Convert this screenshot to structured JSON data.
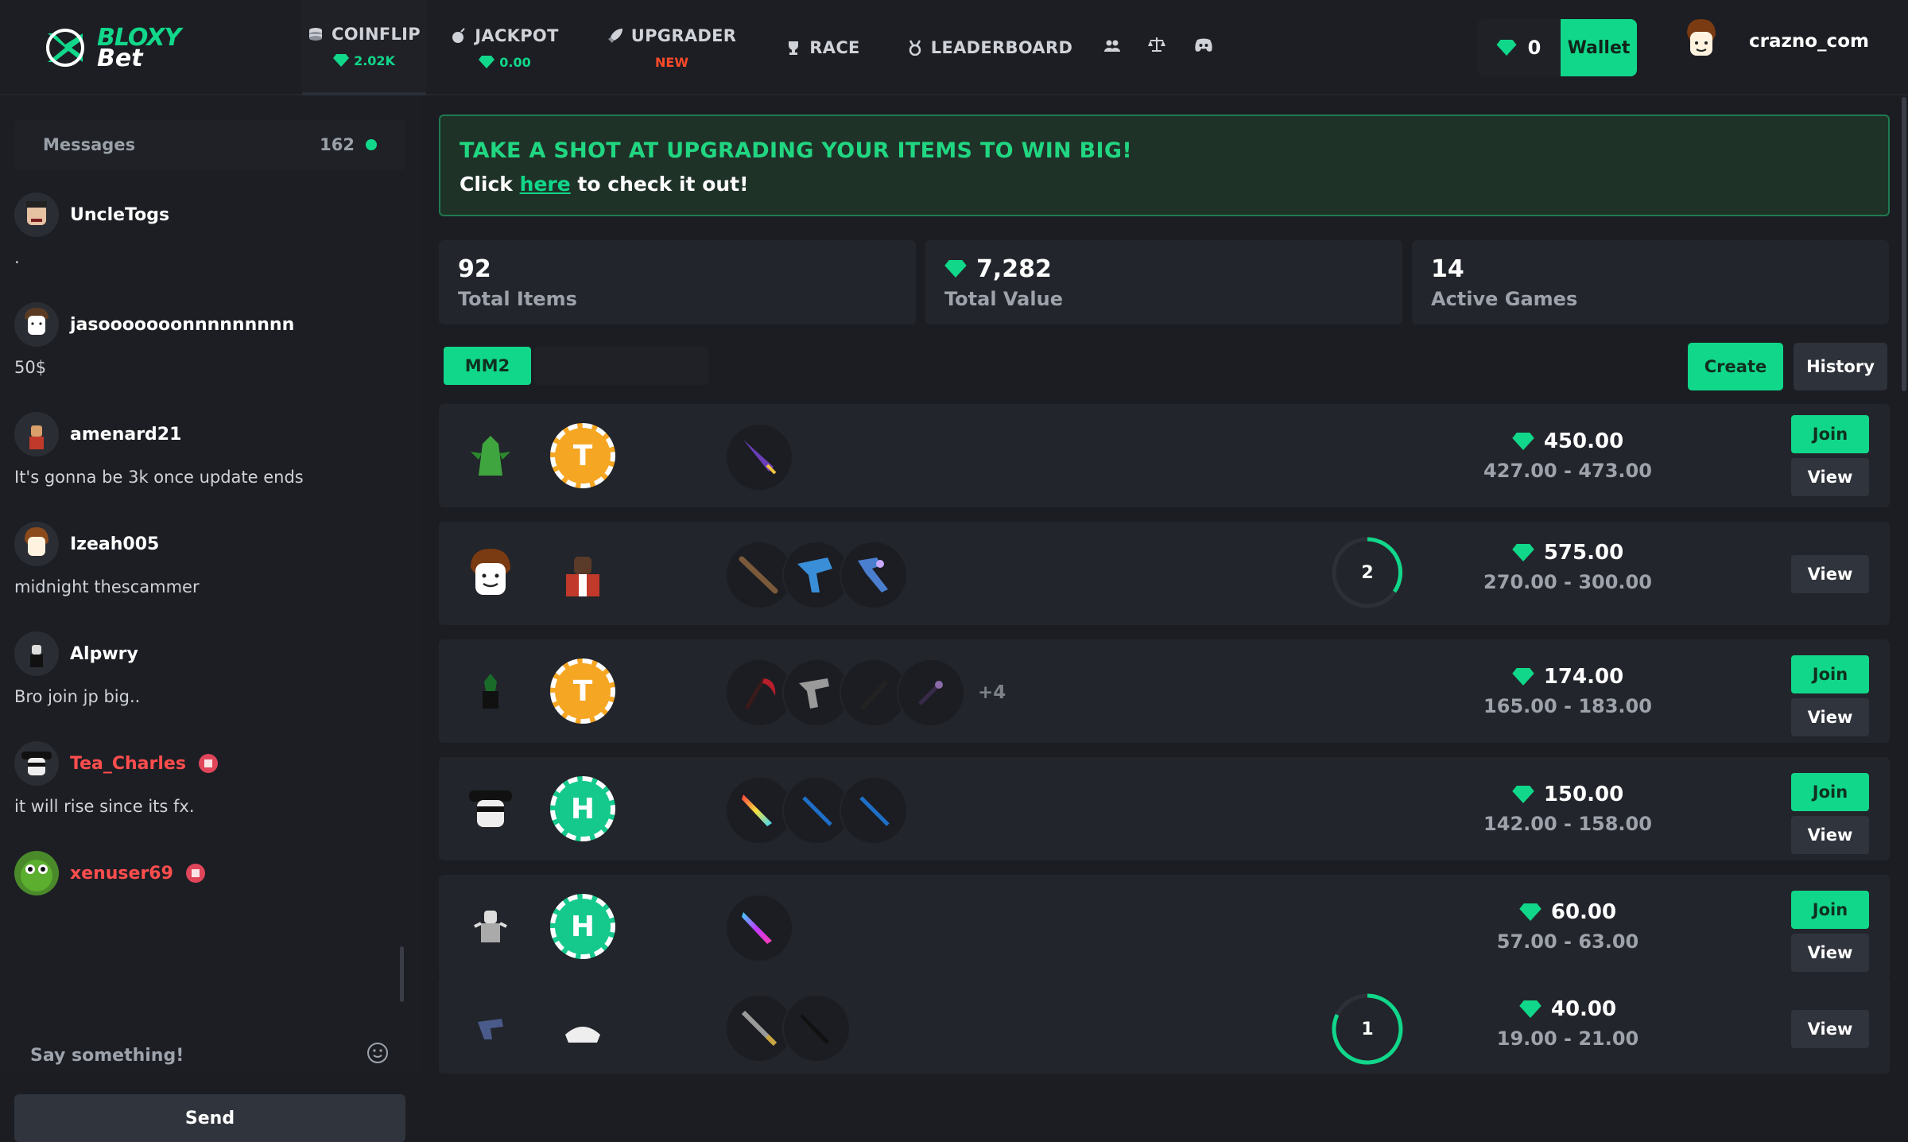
{
  "brand": {
    "line1": "BLOXY",
    "line2": "Bet"
  },
  "nav": [
    {
      "label": "COINFLIP",
      "sub": "2.02K",
      "icon": "coins-icon"
    },
    {
      "label": "JACKPOT",
      "sub": "0.00",
      "icon": "bomb-icon"
    },
    {
      "label": "UPGRADER",
      "sub": "NEW",
      "icon": "rocket-icon"
    },
    {
      "label": "RACE",
      "icon": "trophy-icon"
    },
    {
      "label": "LEADERBOARD",
      "icon": "medal-icon"
    }
  ],
  "header": {
    "balance": "0",
    "wallet": "Wallet",
    "username": "crazno_com"
  },
  "chat": {
    "title": "Messages",
    "count": "162",
    "messages": [
      {
        "user": "UncleTogs",
        "text": "."
      },
      {
        "user": "jasooooooonnnnnnnnn",
        "text": "50$"
      },
      {
        "user": "amenard21",
        "text": "It's gonna be 3k once update ends"
      },
      {
        "user": "Izeah005",
        "text": "midnight thescammer"
      },
      {
        "user": "Alpwry",
        "text": "Bro join jp big.."
      },
      {
        "user": "Tea_Charles",
        "text": "it will rise since its fx."
      },
      {
        "user": "xenuser69",
        "text": ""
      }
    ],
    "placeholder": "Say something!",
    "send": "Send"
  },
  "banner": {
    "headline": "TAKE A SHOT AT UPGRADING YOUR ITEMS TO WIN BIG!",
    "pre": "Click",
    "link": "here",
    "post": "to check it out!"
  },
  "stats": [
    {
      "value": "92",
      "label": "Total Items"
    },
    {
      "value": "7,282",
      "label": "Total Value"
    },
    {
      "value": "14",
      "label": "Active Games"
    }
  ],
  "tabs": {
    "active": "MM2",
    "create": "Create",
    "history": "History"
  },
  "games": [
    {
      "price": "450.00",
      "range": "427.00 - 473.00",
      "join": "Join",
      "view": "View"
    },
    {
      "price": "575.00",
      "range": "270.00 - 300.00",
      "timer": "2",
      "view": "View"
    },
    {
      "price": "174.00",
      "range": "165.00 - 183.00",
      "more": "+4",
      "join": "Join",
      "view": "View"
    },
    {
      "price": "150.00",
      "range": "142.00 - 158.00",
      "join": "Join",
      "view": "View"
    },
    {
      "price": "60.00",
      "range": "57.00 - 63.00",
      "join": "Join",
      "view": "View"
    },
    {
      "price": "40.00",
      "range": "19.00 - 21.00",
      "timer": "1",
      "view": "View"
    }
  ],
  "colors": {
    "accent": "#11d78a",
    "danger": "#ff4d4d",
    "new": "#ff4a2a"
  }
}
